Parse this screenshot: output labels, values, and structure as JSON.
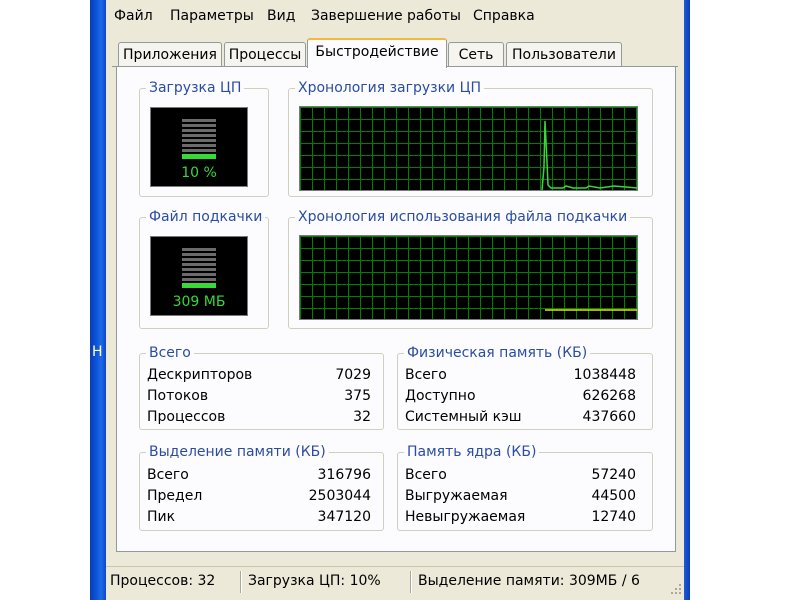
{
  "menu": [
    "Файл",
    "Параметры",
    "Вид",
    "Завершение работы",
    "Справка"
  ],
  "tabs": [
    "Приложения",
    "Процессы",
    "Быстродействие",
    "Сеть",
    "Пользователи"
  ],
  "active_tab": "Быстродействие",
  "cpu": {
    "title": "Загрузка ЦП",
    "value": "10 %",
    "level": 0.1,
    "history_title": "Хронология загрузки ЦП"
  },
  "pagefile": {
    "title": "Файл подкачки",
    "value": "309 МБ",
    "history_title": "Хронология использования файла подкачки"
  },
  "totals": {
    "title": "Всего",
    "rows": [
      {
        "label": "Дескрипторов",
        "value": "7029"
      },
      {
        "label": "Потоков",
        "value": "375"
      },
      {
        "label": "Процессов",
        "value": "32"
      }
    ]
  },
  "physical": {
    "title": "Физическая память (КБ)",
    "rows": [
      {
        "label": "Всего",
        "value": "1038448"
      },
      {
        "label": "Доступно",
        "value": "626268"
      },
      {
        "label": "Системный кэш",
        "value": "437660"
      }
    ]
  },
  "commit": {
    "title": "Выделение памяти (КБ)",
    "rows": [
      {
        "label": "Всего",
        "value": "316796"
      },
      {
        "label": "Предел",
        "value": "2503044"
      },
      {
        "label": "Пик",
        "value": "347120"
      }
    ]
  },
  "kernel": {
    "title": "Память ядра (КБ)",
    "rows": [
      {
        "label": "Всего",
        "value": "57240"
      },
      {
        "label": "Выгружаемая",
        "value": "44500"
      },
      {
        "label": "Невыгружаемая",
        "value": "12740"
      }
    ]
  },
  "status": {
    "processes": "Процессов: 32",
    "cpu": "Загрузка ЦП: 10%",
    "commit": "Выделение памяти: 309МБ / 6"
  },
  "colors": {
    "graph_grid": "#008000",
    "graph_line": "#37d937",
    "pagefile_line": "#e8e800",
    "group_title": "#2b4ca4"
  }
}
